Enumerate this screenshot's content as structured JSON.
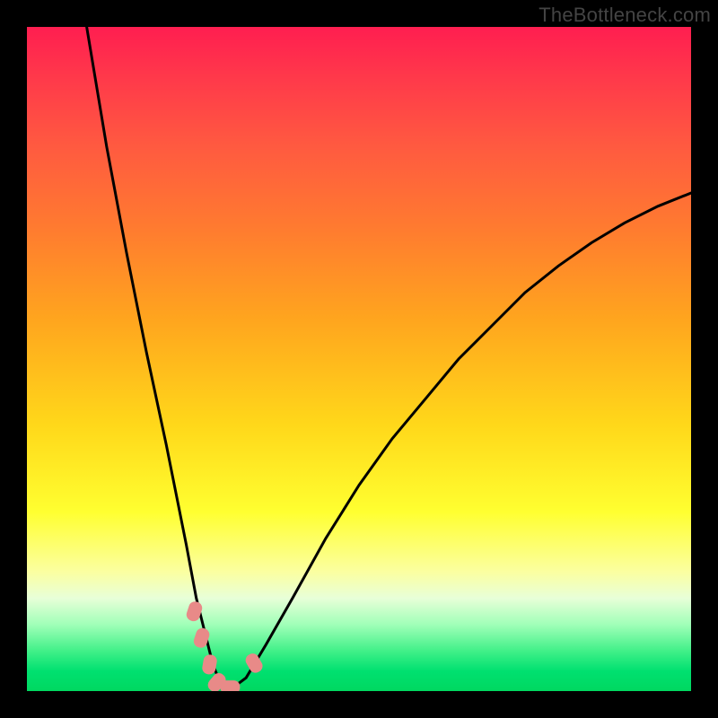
{
  "watermark": "TheBottleneck.com",
  "chart_data": {
    "type": "line",
    "title": "",
    "xlabel": "",
    "ylabel": "",
    "xlim": [
      0,
      100
    ],
    "ylim": [
      0,
      100
    ],
    "series": [
      {
        "name": "curve",
        "x": [
          9,
          12,
          15,
          18,
          21,
          24,
          25.5,
          27,
          28,
          29,
          30,
          31,
          33,
          36,
          40,
          45,
          50,
          55,
          60,
          65,
          70,
          75,
          80,
          85,
          90,
          95,
          100
        ],
        "y": [
          100,
          82,
          66,
          51,
          37,
          22,
          14,
          8,
          4,
          1.5,
          0.5,
          0.5,
          2,
          7,
          14,
          23,
          31,
          38,
          44,
          50,
          55,
          60,
          64,
          67.5,
          70.5,
          73,
          75
        ]
      }
    ],
    "markers": [
      {
        "x": 25.2,
        "y": 12.0
      },
      {
        "x": 26.3,
        "y": 8.0
      },
      {
        "x": 27.5,
        "y": 4.0
      },
      {
        "x": 28.6,
        "y": 1.3
      },
      {
        "x": 30.6,
        "y": 0.6
      },
      {
        "x": 34.2,
        "y": 4.2
      }
    ],
    "colors": {
      "curve_stroke": "#000000",
      "marker_fill": "#e88a88",
      "gradient_top": "#ff1e50",
      "gradient_bottom": "#00d860"
    }
  }
}
